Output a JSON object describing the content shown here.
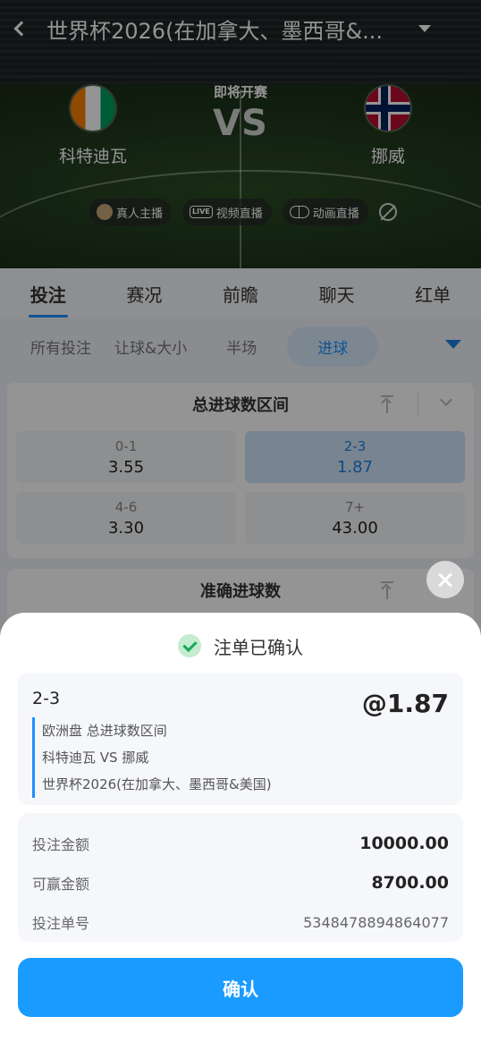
{
  "header": {
    "title": "世界杯2026(在加拿大、墨西哥&...",
    "status": "即将开赛",
    "vs": "VS",
    "home_team": "科特迪瓦",
    "away_team": "挪威",
    "live_buttons": [
      "真人主播",
      "视频直播",
      "动画直播"
    ]
  },
  "tabs": [
    "投注",
    "赛况",
    "前瞻",
    "聊天",
    "红单"
  ],
  "subtabs": [
    "所有投注",
    "让球&大小",
    "半场",
    "进球"
  ],
  "markets": {
    "total_goals": {
      "title": "总进球数区间",
      "options": [
        {
          "label": "0-1",
          "odds": "3.55"
        },
        {
          "label": "2-3",
          "odds": "1.87"
        },
        {
          "label": "4-6",
          "odds": "3.30"
        },
        {
          "label": "7+",
          "odds": "43.00"
        }
      ]
    },
    "exact_goals": {
      "title": "准确进球数"
    }
  },
  "sheet": {
    "title": "注单已确认",
    "bet": {
      "selection": "2-3",
      "odds": "@1.87",
      "market": "欧洲盘 总进球数区间",
      "match": "科特迪瓦 VS  挪威",
      "league": "世界杯2026(在加拿大、墨西哥&美国)"
    },
    "summary": {
      "stake_label": "投注金额",
      "stake_value": "10000.00",
      "win_label": "可赢金额",
      "win_value": "8700.00",
      "id_label": "投注单号",
      "id_value": "5348478894864077"
    },
    "confirm": "确认"
  },
  "colors": {
    "accent": "#1a9bff",
    "selected_bg": "#cfe3f8",
    "success": "#19a855"
  }
}
